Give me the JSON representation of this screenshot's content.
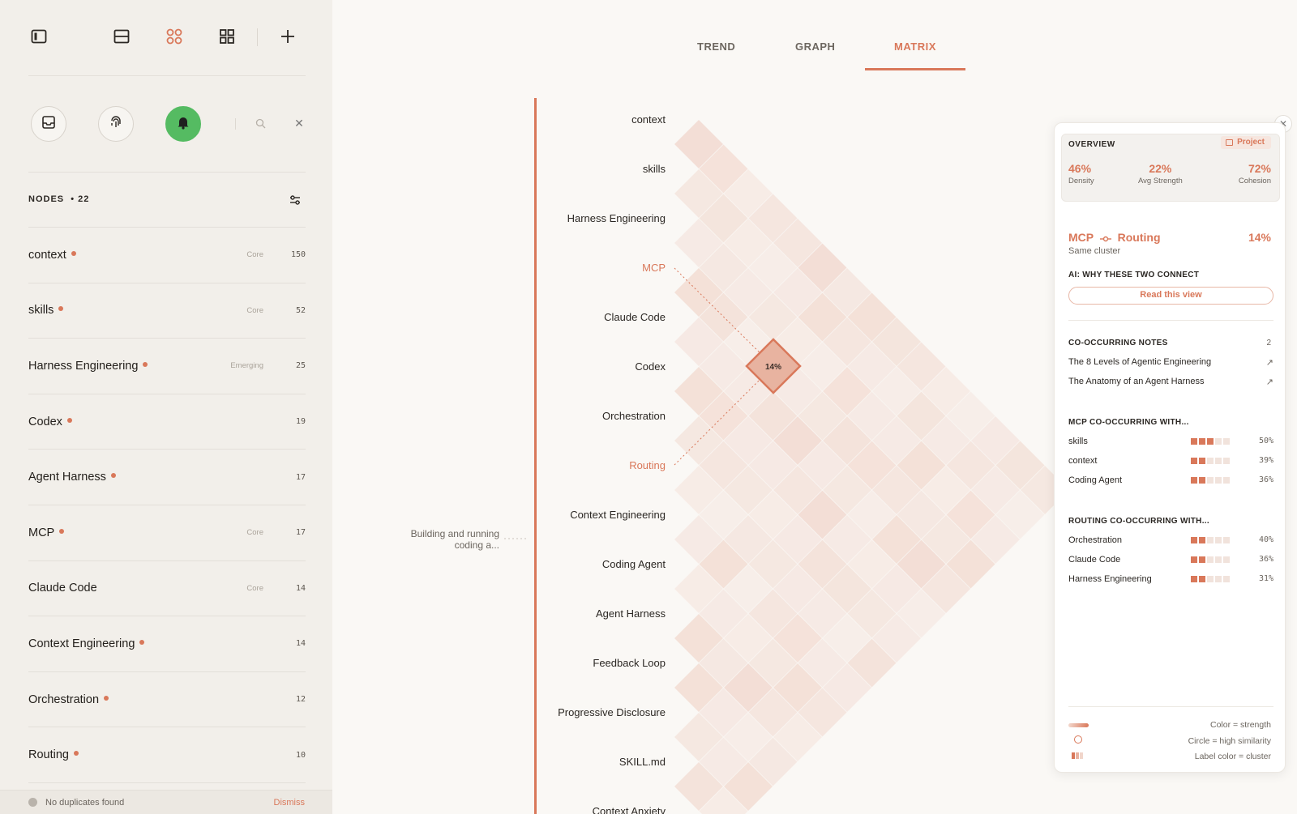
{
  "app": {
    "accent": "#d9785a",
    "status_green": "#55bb62"
  },
  "toolbar": {
    "icons": [
      "sidebar-toggle-icon",
      "split-view-icon",
      "graph-nodes-icon",
      "grid-icon",
      "plus-icon"
    ]
  },
  "quick_actions": [
    "inbox-icon",
    "fingerprint-icon",
    "bell-icon",
    "search-icon",
    "close-icon"
  ],
  "nodes": {
    "label": "NODES",
    "count": "• 22",
    "items": [
      {
        "name": "context",
        "tag": "Core",
        "count": "150"
      },
      {
        "name": "skills",
        "tag": "Core",
        "count": "52"
      },
      {
        "name": "Harness Engineering",
        "tag": "Emerging",
        "count": "25"
      },
      {
        "name": "Codex",
        "tag": "",
        "count": "19"
      },
      {
        "name": "Agent Harness",
        "tag": "",
        "count": "17"
      },
      {
        "name": "MCP",
        "tag": "Core",
        "count": "17"
      },
      {
        "name": "Claude Code",
        "tag": "Core",
        "count": "14"
      },
      {
        "name": "Context Engineering",
        "tag": "",
        "count": "14"
      },
      {
        "name": "Orchestration",
        "tag": "",
        "count": "12"
      },
      {
        "name": "Routing",
        "tag": "",
        "count": "10"
      }
    ]
  },
  "duplicates": {
    "message": "No duplicates found",
    "dismiss": "Dismiss"
  },
  "tabs": [
    {
      "label": "TREND",
      "active": false
    },
    {
      "label": "GRAPH",
      "active": false
    },
    {
      "label": "MATRIX",
      "active": true
    }
  ],
  "matrix": {
    "rows": [
      "context",
      "skills",
      "Harness Engineering",
      "MCP",
      "Claude Code",
      "Codex",
      "Orchestration",
      "Routing",
      "Context Engineering",
      "Coding Agent",
      "Agent Harness",
      "Feedback Loop",
      "Progressive Disclosure",
      "SKILL.md",
      "Context Anxiety"
    ],
    "highlighted_rows": [
      "MCP",
      "Routing"
    ],
    "selected_cell": {
      "row": "MCP",
      "col": "Routing",
      "label": "14%"
    },
    "cluster_note": "Building and running coding a..."
  },
  "panel": {
    "overview": {
      "title": "OVERVIEW",
      "badge": "Project",
      "stats": [
        {
          "value": "46%",
          "label": "Density"
        },
        {
          "value": "22%",
          "label": "Avg Strength"
        },
        {
          "value": "72%",
          "label": "Cohesion"
        }
      ]
    },
    "pair": {
      "a": "MCP",
      "b": "Routing",
      "pct": "14%",
      "sub": "Same cluster"
    },
    "ai": {
      "title": "AI: WHY THESE TWO CONNECT",
      "button": "Read this view"
    },
    "notes": {
      "title": "CO-OCCURRING NOTES",
      "count": "2",
      "items": [
        "The 8 Levels of Agentic Engineering",
        "The Anatomy of an Agent Harness"
      ]
    },
    "mcp_co": {
      "title": "MCP CO-OCCURRING WITH...",
      "items": [
        {
          "name": "skills",
          "pct": "50%",
          "level": 3
        },
        {
          "name": "context",
          "pct": "39%",
          "level": 2
        },
        {
          "name": "Coding Agent",
          "pct": "36%",
          "level": 2
        }
      ]
    },
    "routing_co": {
      "title": "ROUTING CO-OCCURRING WITH...",
      "items": [
        {
          "name": "Orchestration",
          "pct": "40%",
          "level": 2
        },
        {
          "name": "Claude Code",
          "pct": "36%",
          "level": 2
        },
        {
          "name": "Harness Engineering",
          "pct": "31%",
          "level": 2
        }
      ]
    },
    "legend": [
      {
        "label": "Color = strength"
      },
      {
        "label": "Circle = high similarity"
      },
      {
        "label": "Label color = cluster"
      }
    ]
  }
}
